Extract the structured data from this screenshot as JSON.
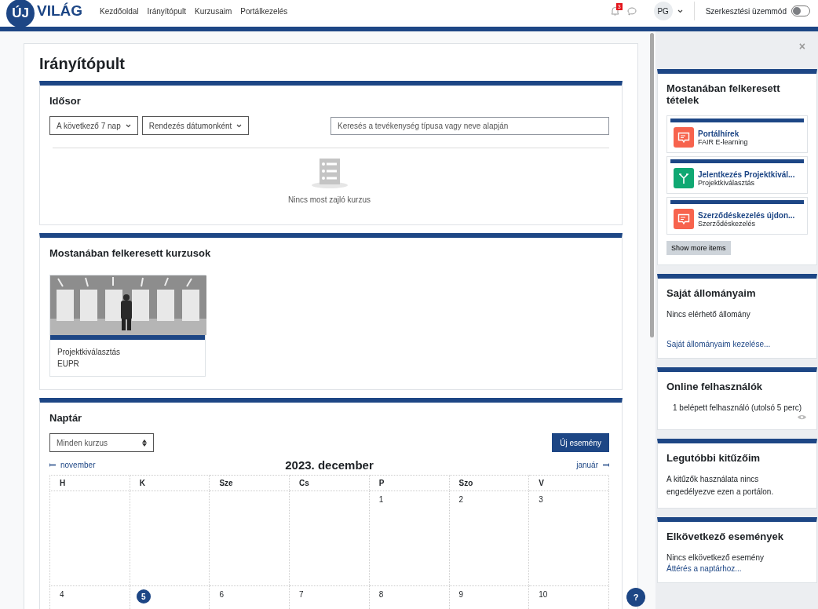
{
  "header": {
    "logo": {
      "mark": "ÚJ",
      "word": "VILÁG"
    },
    "nav": [
      {
        "label": "Kezdőoldal"
      },
      {
        "label": "Irányítópult"
      },
      {
        "label": "Kurzusaim"
      },
      {
        "label": "Portálkezelés"
      }
    ],
    "notification_count": "3",
    "user_initials": "PG",
    "edit_mode": {
      "label": "Szerkesztési üzemmód",
      "on": false
    }
  },
  "main": {
    "title": "Irányítópult",
    "timeline": {
      "title": "Idősor",
      "filters": [
        "A következő 7 nap",
        "Rendezés dátumonként"
      ],
      "search": {
        "placeholder": "Keresés a tevékenység típusa vagy neve alapján"
      },
      "empty_text": "Nincs most zajló kurzus"
    },
    "recent_courses": {
      "title": "Mostanában felkeresett kurzusok",
      "courses": [
        {
          "kind": "picture",
          "name": "Projektkiválasztás",
          "category": "EUPR"
        }
      ]
    },
    "calendar": {
      "title": "Naptár",
      "course_select": "Minden kurzus",
      "new_event_button": "Új esemény",
      "prev": "november",
      "month": "2023. december",
      "next": "január",
      "weekdays": [
        "H",
        "K",
        "Sze",
        "Cs",
        "P",
        "Szo",
        "V"
      ],
      "weeks": [
        [
          {
            "day": "1",
            "today": false
          },
          {
            "day": "2",
            "today": false
          },
          {
            "day": "3",
            "today": false
          }
        ],
        [
          {
            "day": "4",
            "today": false
          },
          {
            "day": "5",
            "today": true
          },
          {
            "day": "6",
            "today": false
          },
          {
            "day": "7",
            "today": false
          },
          {
            "day": "8",
            "today": false
          },
          {
            "day": "9",
            "today": false
          },
          {
            "day": "10",
            "today": false
          }
        ]
      ]
    }
  },
  "drawer": {
    "close": "×",
    "blocks": [
      {
        "kind": "recent_items",
        "title": "Mostanában felkeresett tételek",
        "items": [
          {
            "kind": "forum",
            "color": "#f7634d",
            "title": "Portálhírek",
            "subtitle": "FAIR E-learning"
          },
          {
            "kind": "choice",
            "color": "#0fa872",
            "title": "Jelentkezés Projektkivál...",
            "subtitle": "Projektkiválasztás"
          },
          {
            "kind": "forum",
            "color": "#f7634d",
            "title": "Szerződéskezelés újdon...",
            "subtitle": "Szerződéskezelés"
          }
        ],
        "button": "Show more items"
      },
      {
        "kind": "files",
        "title": "Saját állományaim",
        "text": "Nincs elérhető állomány",
        "link": "Saját állományaim kezelése..."
      },
      {
        "kind": "online_users",
        "title": "Online felhasználók",
        "text": "1 belépett felhasználó (utolsó 5 perc)"
      },
      {
        "kind": "text",
        "title": "Legutóbbi kitűzőim",
        "text": "A kitűzők használata nincs engedélyezve ezen a portálon."
      },
      {
        "kind": "events",
        "title": "Elkövetkező események",
        "text": "Nincs elkövetkező esemény",
        "link": "Áttérés a naptárhoz..."
      }
    ]
  },
  "help_button": "?"
}
